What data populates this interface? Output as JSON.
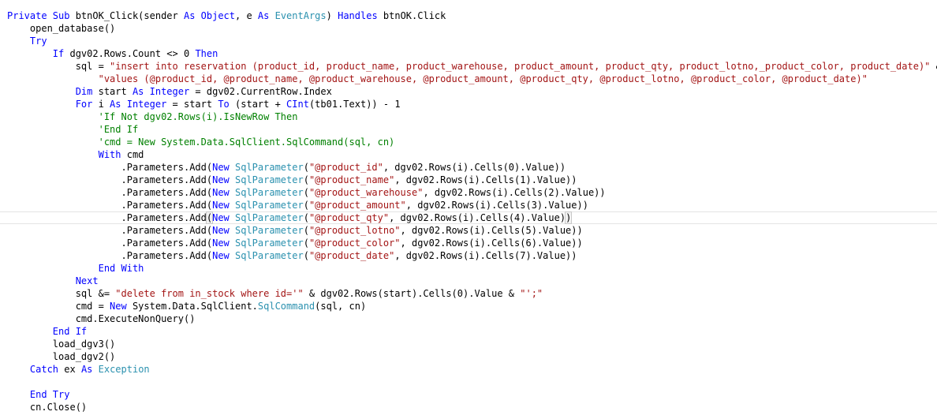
{
  "editor": {
    "current_line": 16,
    "lines": [
      {
        "tokens": [
          [
            "kw",
            "Private Sub "
          ],
          [
            "plain",
            "btnOK_Click(sender "
          ],
          [
            "kw",
            "As Object"
          ],
          [
            "plain",
            ", e "
          ],
          [
            "kw",
            "As "
          ],
          [
            "type",
            "EventArgs"
          ],
          [
            "plain",
            ") "
          ],
          [
            "kw",
            "Handles "
          ],
          [
            "plain",
            "btnOK.Click"
          ]
        ]
      },
      {
        "tokens": [
          [
            "plain",
            "    open_database()"
          ]
        ]
      },
      {
        "tokens": [
          [
            "kw",
            "    Try"
          ]
        ]
      },
      {
        "tokens": [
          [
            "kw",
            "        If "
          ],
          [
            "plain",
            "dgv02.Rows.Count <> 0 "
          ],
          [
            "kw",
            "Then"
          ]
        ]
      },
      {
        "tokens": [
          [
            "plain",
            "            sql = "
          ],
          [
            "str",
            "\"insert into reservation (product_id, product_name, product_warehouse, product_amount, product_qty, product_lotno,_product_color, product_date)\""
          ],
          [
            "plain",
            " & _"
          ]
        ]
      },
      {
        "tokens": [
          [
            "plain",
            "                "
          ],
          [
            "str",
            "\"values (@product_id, @product_name, @product_warehouse, @product_amount, @product_qty, @product_lotno, @product_color, @product_date)\""
          ]
        ]
      },
      {
        "tokens": [
          [
            "kw",
            "            Dim "
          ],
          [
            "plain",
            "start "
          ],
          [
            "kw",
            "As Integer"
          ],
          [
            "plain",
            " = dgv02.CurrentRow.Index"
          ]
        ]
      },
      {
        "tokens": [
          [
            "kw",
            "            For "
          ],
          [
            "plain",
            "i "
          ],
          [
            "kw",
            "As Integer"
          ],
          [
            "plain",
            " = start "
          ],
          [
            "kw",
            "To "
          ],
          [
            "plain",
            "(start + "
          ],
          [
            "kw",
            "CInt"
          ],
          [
            "plain",
            "(tb01.Text)) - 1"
          ]
        ]
      },
      {
        "tokens": [
          [
            "plain",
            "                "
          ],
          [
            "cm",
            "'If Not dgv02.Rows(i).IsNewRow Then"
          ]
        ]
      },
      {
        "tokens": [
          [
            "plain",
            "                "
          ],
          [
            "cm",
            "'End If"
          ]
        ]
      },
      {
        "tokens": [
          [
            "plain",
            "                "
          ],
          [
            "cm",
            "'cmd = New System.Data.SqlClient.SqlCommand(sql, cn)"
          ]
        ]
      },
      {
        "tokens": [
          [
            "kw",
            "                With "
          ],
          [
            "plain",
            "cmd"
          ]
        ]
      },
      {
        "tokens": [
          [
            "plain",
            "                    .Parameters.Add("
          ],
          [
            "kw",
            "New "
          ],
          [
            "type",
            "SqlParameter"
          ],
          [
            "plain",
            "("
          ],
          [
            "str",
            "\"@product_id\""
          ],
          [
            "plain",
            ", dgv02.Rows(i).Cells(0).Value))"
          ]
        ]
      },
      {
        "tokens": [
          [
            "plain",
            "                    .Parameters.Add("
          ],
          [
            "kw",
            "New "
          ],
          [
            "type",
            "SqlParameter"
          ],
          [
            "plain",
            "("
          ],
          [
            "str",
            "\"@product_name\""
          ],
          [
            "plain",
            ", dgv02.Rows(i).Cells(1).Value))"
          ]
        ]
      },
      {
        "tokens": [
          [
            "plain",
            "                    .Parameters.Add("
          ],
          [
            "kw",
            "New "
          ],
          [
            "type",
            "SqlParameter"
          ],
          [
            "plain",
            "("
          ],
          [
            "str",
            "\"@product_warehouse\""
          ],
          [
            "plain",
            ", dgv02.Rows(i).Cells(2).Value))"
          ]
        ]
      },
      {
        "tokens": [
          [
            "plain",
            "                    .Parameters.Add("
          ],
          [
            "kw",
            "New "
          ],
          [
            "type",
            "SqlParameter"
          ],
          [
            "plain",
            "("
          ],
          [
            "str",
            "\"@product_amount\""
          ],
          [
            "plain",
            ", dgv02.Rows(i).Cells(3).Value))"
          ]
        ]
      },
      {
        "tokens": [
          [
            "plain",
            "                    .Parameters.Add"
          ],
          [
            "brace",
            "("
          ],
          [
            "kw",
            "New "
          ],
          [
            "type",
            "SqlParameter"
          ],
          [
            "plain",
            "("
          ],
          [
            "str",
            "\"@product_qty\""
          ],
          [
            "plain",
            ", dgv02.Rows(i).Cells(4).Value)"
          ],
          [
            "brace",
            ")"
          ]
        ]
      },
      {
        "tokens": [
          [
            "plain",
            "                    .Parameters.Add("
          ],
          [
            "kw",
            "New "
          ],
          [
            "type",
            "SqlParameter"
          ],
          [
            "plain",
            "("
          ],
          [
            "str",
            "\"@product_lotno\""
          ],
          [
            "plain",
            ", dgv02.Rows(i).Cells(5).Value))"
          ]
        ]
      },
      {
        "tokens": [
          [
            "plain",
            "                    .Parameters.Add("
          ],
          [
            "kw",
            "New "
          ],
          [
            "type",
            "SqlParameter"
          ],
          [
            "plain",
            "("
          ],
          [
            "str",
            "\"@product_color\""
          ],
          [
            "plain",
            ", dgv02.Rows(i).Cells(6).Value))"
          ]
        ]
      },
      {
        "tokens": [
          [
            "plain",
            "                    .Parameters.Add("
          ],
          [
            "kw",
            "New "
          ],
          [
            "type",
            "SqlParameter"
          ],
          [
            "plain",
            "("
          ],
          [
            "str",
            "\"@product_date\""
          ],
          [
            "plain",
            ", dgv02.Rows(i).Cells(7).Value))"
          ]
        ]
      },
      {
        "tokens": [
          [
            "kw",
            "                End With"
          ]
        ]
      },
      {
        "tokens": [
          [
            "kw",
            "            Next"
          ]
        ]
      },
      {
        "tokens": [
          [
            "plain",
            "            sql &= "
          ],
          [
            "str",
            "\"delete from in_stock where id='\""
          ],
          [
            "plain",
            " & dgv02.Rows(start).Cells(0).Value & "
          ],
          [
            "str",
            "\"';\""
          ]
        ]
      },
      {
        "tokens": [
          [
            "plain",
            "            cmd = "
          ],
          [
            "kw",
            "New "
          ],
          [
            "plain",
            "System.Data.SqlClient."
          ],
          [
            "type",
            "SqlCommand"
          ],
          [
            "plain",
            "(sql, cn)"
          ]
        ]
      },
      {
        "tokens": [
          [
            "plain",
            "            cmd.ExecuteNonQuery()"
          ]
        ]
      },
      {
        "tokens": [
          [
            "kw",
            "        End If"
          ]
        ]
      },
      {
        "tokens": [
          [
            "plain",
            "        load_dgv3()"
          ]
        ]
      },
      {
        "tokens": [
          [
            "plain",
            "        load_dgv2()"
          ]
        ]
      },
      {
        "tokens": [
          [
            "kw",
            "    Catch "
          ],
          [
            "plain",
            "ex "
          ],
          [
            "kw",
            "As "
          ],
          [
            "type",
            "Exception"
          ]
        ]
      },
      {
        "tokens": []
      },
      {
        "tokens": [
          [
            "kw",
            "    End Try"
          ]
        ]
      },
      {
        "tokens": [
          [
            "plain",
            "    cn.Close()"
          ]
        ]
      }
    ]
  },
  "colors": {
    "keyword": "#0000ff",
    "string": "#a31515",
    "type": "#2b91af",
    "comment": "#008000",
    "plain": "#000000"
  }
}
